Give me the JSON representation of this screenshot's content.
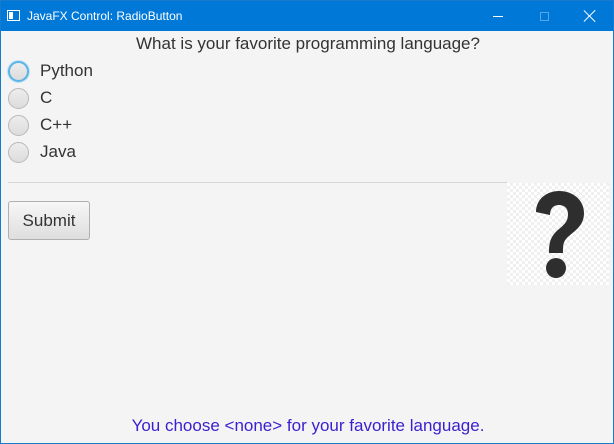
{
  "window": {
    "title": "JavaFX Control: RadioButton",
    "controls": [
      "minimize",
      "maximize",
      "close"
    ]
  },
  "main": {
    "question": "What is your favorite programming language?",
    "options": [
      {
        "label": "Python",
        "selected": false,
        "focused": true
      },
      {
        "label": "C",
        "selected": false,
        "focused": false
      },
      {
        "label": "C++",
        "selected": false,
        "focused": false
      },
      {
        "label": "Java",
        "selected": false,
        "focused": false
      }
    ],
    "submit_label": "Submit",
    "image_icon": "question-mark-icon",
    "status_text": "You choose <none> for your favorite language."
  },
  "colors": {
    "titlebar": "#0078d7",
    "focus_ring": "#5ab4e6",
    "status_text": "#3a1fcf"
  }
}
